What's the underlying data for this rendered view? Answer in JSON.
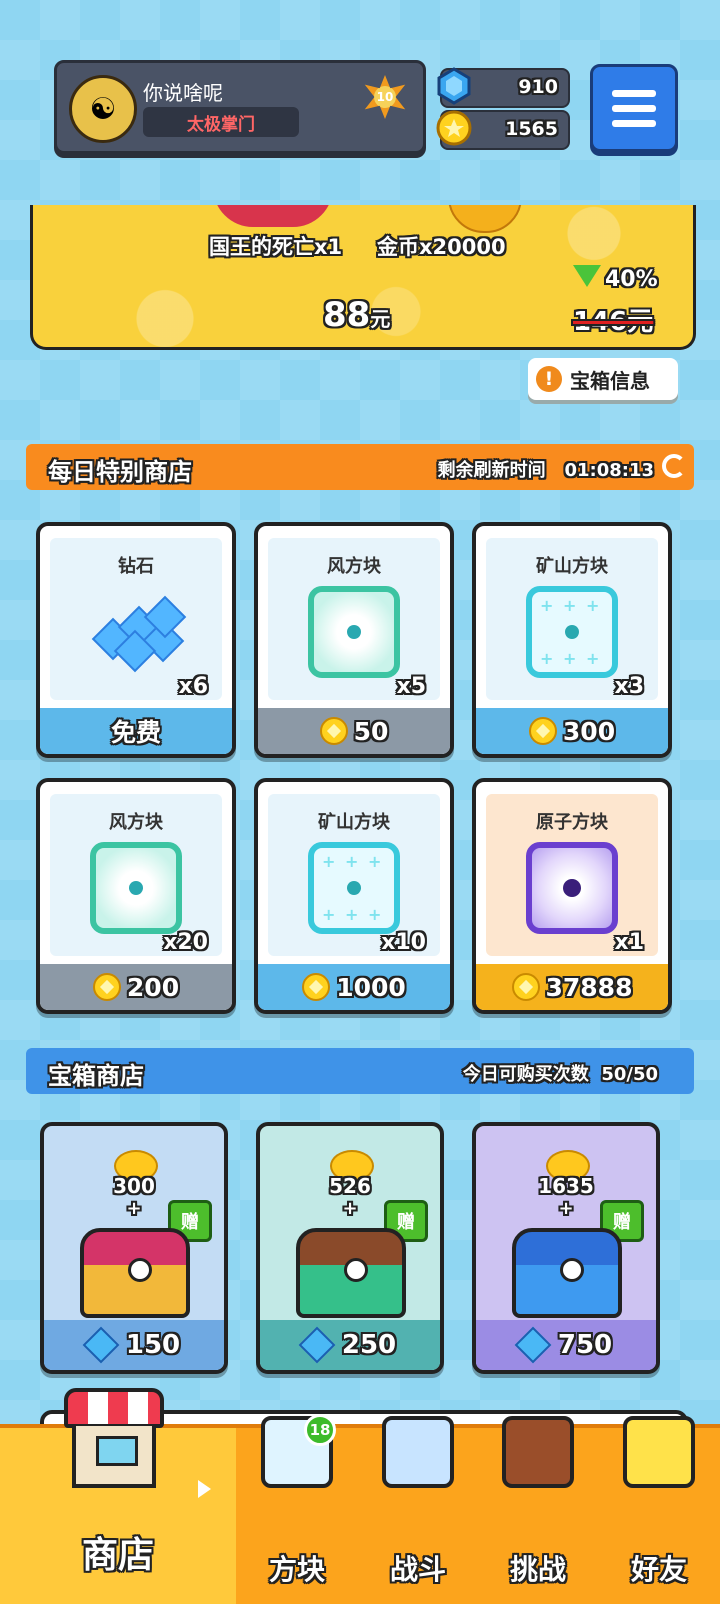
{
  "player": {
    "name": "你说啥呢",
    "title": "太极掌门",
    "level": "10"
  },
  "currency": {
    "gems": "910",
    "coins": "1565"
  },
  "promo": {
    "item1": "国王的死亡x1",
    "item2": "金币x20000",
    "price": "88",
    "price_unit": "元",
    "discount": "40%",
    "old_price": "146元"
  },
  "chest_info_label": "宝箱信息",
  "daily_shop": {
    "title": "每日特别商店",
    "refresh_label": "剩余刷新时间",
    "refresh_time": "01:08:13",
    "items": [
      {
        "name": "钻石",
        "qty": "x6",
        "price": "免费",
        "currency": "none"
      },
      {
        "name": "风方块",
        "qty": "x5",
        "price": "50",
        "currency": "coin"
      },
      {
        "name": "矿山方块",
        "qty": "x3",
        "price": "300",
        "currency": "coin"
      },
      {
        "name": "风方块",
        "qty": "x20",
        "price": "200",
        "currency": "coin"
      },
      {
        "name": "矿山方块",
        "qty": "x10",
        "price": "1000",
        "currency": "coin"
      },
      {
        "name": "原子方块",
        "qty": "x1",
        "price": "37888",
        "currency": "coin"
      }
    ]
  },
  "chest_shop": {
    "title": "宝箱商店",
    "limit_label": "今日可购买次数",
    "limit_value": "50/50",
    "gift_label": "赠",
    "plus": "+",
    "chests": [
      {
        "coins": "300",
        "price": "150"
      },
      {
        "coins": "526",
        "price": "250"
      },
      {
        "coins": "1635",
        "price": "750"
      }
    ]
  },
  "nav": {
    "shop": "商店",
    "blocks": "方块",
    "blocks_badge": "18",
    "battle": "战斗",
    "challenge": "挑战",
    "friends": "好友"
  },
  "colors": {
    "background": "#8fd6f2",
    "daily_bar": "#f98b1e",
    "chest_bar": "#3f93e8",
    "nav": "#fca41c",
    "footer_blue": "#5db8ea",
    "footer_gray": "#8c99a6",
    "footer_gold": "#f5b21c"
  }
}
